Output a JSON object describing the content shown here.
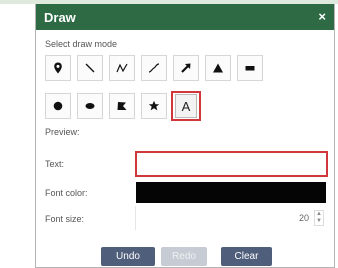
{
  "dialog": {
    "title": "Draw",
    "close_glyph": "×"
  },
  "draw_mode": {
    "label": "Select draw mode",
    "modes": [
      {
        "icon": "point-marker-icon"
      },
      {
        "icon": "line-icon"
      },
      {
        "icon": "polyline-icon"
      },
      {
        "icon": "freehand-line-icon"
      },
      {
        "icon": "arrow-icon"
      },
      {
        "icon": "triangle-icon"
      },
      {
        "icon": "rectangle-icon"
      },
      {
        "icon": "circle-icon"
      },
      {
        "icon": "ellipse-icon"
      },
      {
        "icon": "polygon-icon"
      },
      {
        "icon": "freehand-polygon-icon"
      },
      {
        "icon": "text-icon",
        "glyph": "A",
        "selected": true
      }
    ]
  },
  "preview": {
    "label": "Preview:",
    "text_label": "Text:",
    "text_value": "",
    "font_color_label": "Font color:",
    "font_color": "#050505",
    "font_size_label": "Font size:",
    "font_size_value": "20"
  },
  "footer": {
    "undo_label": "Undo",
    "redo_label": "Redo",
    "clear_label": "Clear"
  },
  "colors": {
    "title_bar": "#2e6b44",
    "selected_border": "#d1363c",
    "button_bg": "#4f5e7b",
    "button_disabled_bg": "#c7ccd4"
  }
}
